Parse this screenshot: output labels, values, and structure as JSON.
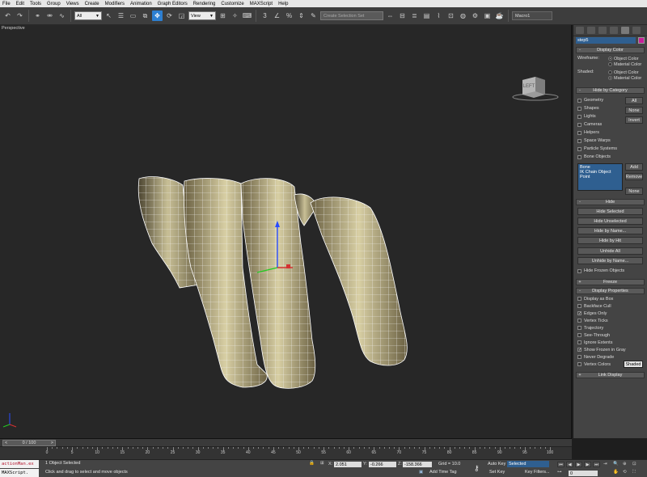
{
  "menu": [
    "File",
    "Edit",
    "Tools",
    "Group",
    "Views",
    "Create",
    "Modifiers",
    "Animation",
    "Graph Editors",
    "Rendering",
    "Customize",
    "MAXScript",
    "Help"
  ],
  "toolbar": {
    "filter": "All",
    "refcoord": "View",
    "selection_set_placeholder": "Create Selection Set",
    "macro": "Macro1"
  },
  "viewport": {
    "label": "Perspective",
    "viewcube_face": "LEFT"
  },
  "panel": {
    "object_name": "step5",
    "object_color": "#c81f9a",
    "display_color": {
      "title": "Display Color",
      "wireframe_label": "Wireframe:",
      "shaded_label": "Shaded:",
      "opt_object": "Object Color",
      "opt_material": "Material Color"
    },
    "hide_by_category": {
      "title": "Hide by Category",
      "items": [
        "Geometry",
        "Shapes",
        "Lights",
        "Cameras",
        "Helpers",
        "Space Warps",
        "Particle Systems",
        "Bone Objects"
      ],
      "btn_all": "All",
      "btn_none": "None",
      "btn_invert": "Invert",
      "list": [
        "Bone",
        "IK Chain Object",
        "Point"
      ],
      "btn_add": "Add",
      "btn_remove": "Remove",
      "btn_none2": "None"
    },
    "hide": {
      "title": "Hide",
      "buttons": [
        "Hide Selected",
        "Hide Unselected",
        "Hide by Name...",
        "Hide by Hit"
      ],
      "unhide": [
        "Unhide All",
        "Unhide by Name..."
      ],
      "frozen": "Hide Frozen Objects"
    },
    "freeze": {
      "title": "Freeze"
    },
    "display_properties": {
      "title": "Display Properties",
      "items": [
        {
          "label": "Display as Box",
          "checked": false
        },
        {
          "label": "Backface Cull",
          "checked": false
        },
        {
          "label": "Edges Only",
          "checked": true
        },
        {
          "label": "Vertex Ticks",
          "checked": false
        },
        {
          "label": "Trajectory",
          "checked": false
        },
        {
          "label": "See-Through",
          "checked": false
        },
        {
          "label": "Ignore Extents",
          "checked": false
        },
        {
          "label": "Show Frozen in Gray",
          "checked": true
        },
        {
          "label": "Never Degrade",
          "checked": false
        },
        {
          "label": "Vertex Colors",
          "checked": false
        }
      ],
      "shaded_btn": "Shaded"
    },
    "link_display": {
      "title": "Link Display"
    }
  },
  "timeline": {
    "slider": "0 / 100",
    "prev": "<",
    "next": ">",
    "ticks": [
      "0",
      "5",
      "10",
      "15",
      "20",
      "25",
      "30",
      "35",
      "40",
      "45",
      "50",
      "55",
      "60",
      "65",
      "70",
      "75",
      "80",
      "85",
      "90",
      "95",
      "100"
    ]
  },
  "status": {
    "listener_a": "actionMan.ex",
    "listener_b": "MAXScript.",
    "selected": "1 Object Selected",
    "prompt": "Click and drag to select and move objects",
    "x_label": "X:",
    "x": "2.051",
    "y_label": "Y:",
    "y": "-0.266",
    "z_label": "Z:",
    "z": "-158.366",
    "grid": "Grid = 10.0",
    "add_time_tag": "Add Time Tag",
    "auto_key": "Auto Key",
    "auto_key_mode": "Selected",
    "set_key": "Set Key",
    "key_filters": "Key Filters...",
    "frame": "0"
  }
}
